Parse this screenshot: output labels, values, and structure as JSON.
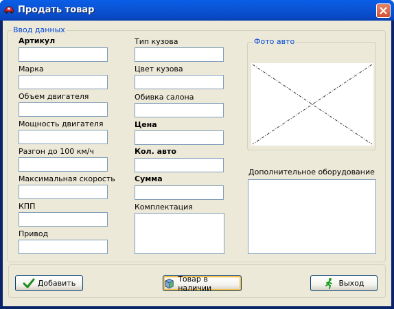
{
  "window": {
    "title": "Продать товар",
    "title_icon": "car-icon",
    "close_icon": "close-icon"
  },
  "input_group": {
    "caption": "Ввод данных",
    "left_fields": [
      {
        "label": "Артикул",
        "bold": true,
        "value": ""
      },
      {
        "label": "Марка",
        "bold": false,
        "value": ""
      },
      {
        "label": "Объем двигателя",
        "bold": false,
        "value": ""
      },
      {
        "label": "Мощность двигателя",
        "bold": false,
        "value": ""
      },
      {
        "label": "Разгон до 100 км/ч",
        "bold": false,
        "value": ""
      },
      {
        "label": "Максимальная скорость",
        "bold": false,
        "value": ""
      },
      {
        "label": "КПП",
        "bold": false,
        "value": ""
      },
      {
        "label": "Привод",
        "bold": false,
        "value": ""
      }
    ],
    "middle_fields": [
      {
        "label": "Тип кузова",
        "bold": false,
        "value": ""
      },
      {
        "label": "Цвет кузова",
        "bold": false,
        "value": ""
      },
      {
        "label": "Обивка салона",
        "bold": false,
        "value": ""
      },
      {
        "label": "Цена",
        "bold": true,
        "value": ""
      },
      {
        "label": "Кол. авто",
        "bold": true,
        "value": ""
      },
      {
        "label": "Сумма",
        "bold": true,
        "value": ""
      }
    ],
    "complectation": {
      "label": "Комплектация",
      "value": ""
    }
  },
  "photo_group": {
    "caption": "Фото авто"
  },
  "extra_equipment": {
    "label": "Дополнительное оборудование",
    "value": ""
  },
  "buttons": {
    "add": {
      "label": "Добавить",
      "icon": "checkmark-icon"
    },
    "in_stock": {
      "label": "Товар в наличии",
      "icon": "box-icon"
    },
    "exit": {
      "label": "Выход",
      "icon": "running-man-icon"
    }
  }
}
